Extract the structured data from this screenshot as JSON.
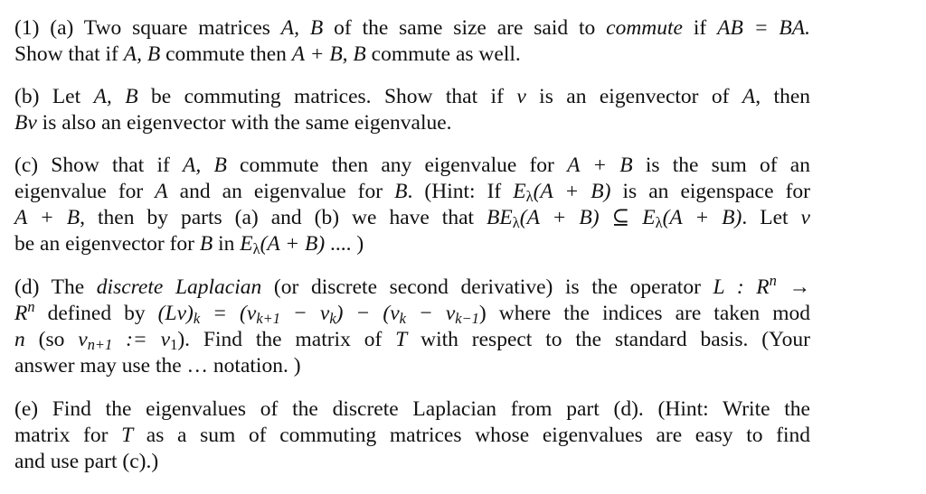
{
  "problem_number": "(1)",
  "parts": [
    {
      "label": "(a)",
      "lines": [
        "(1) (a) Two square matrices A, B of the same size are said to commute if AB = BA.",
        "Show that if A, B commute then A + B, B commute as well."
      ]
    },
    {
      "label": "(b)",
      "lines": [
        "(b) Let A, B be commuting matrices. Show that if v is an eigenvector of A, then",
        "Bv is also an eigenvector with the same eigenvalue."
      ]
    },
    {
      "label": "(c)",
      "lines": [
        "(c) Show that if A, B commute then any eigenvalue for A + B is the sum of an",
        "eigenvalue for A and an eigenvalue for B. (Hint: If Eλ(A + B) is an eigenspace for",
        "A + B, then by parts (a) and (b) we have that BEλ(A + B) ⊆ Eλ(A + B). Let v",
        "be an eigenvector for B in Eλ(A + B) .... )"
      ]
    },
    {
      "label": "(d)",
      "lines": [
        "(d) The discrete Laplacian (or discrete second derivative) is the operator L : R^n →",
        "R^n defined by (Lv)_k = (v_{k+1} − v_k) − (v_k − v_{k−1}) where the indices are taken mod",
        "n (so v_{n+1} := v_1). Find the matrix of T with respect to the standard basis. (Your",
        "answer may use the ... notation. )"
      ]
    },
    {
      "label": "(e)",
      "lines": [
        "(e) Find the eigenvalues of the discrete Laplacian from part (d). (Hint: Write the",
        "matrix for T as a sum of commuting matrices whose eigenvalues are easy to find",
        "and use part (c).)"
      ]
    }
  ],
  "text": {
    "a1_pre": "(1) (a) Two square matrices ",
    "a1_AB": "A, B",
    "a1_mid": " of the same size are said to ",
    "a1_commute": "commute",
    "a1_if": " if ",
    "a1_eq": "AB = BA.",
    "a2_pre": "Show that if ",
    "a2_AB": "A, B",
    "a2_mid": " commute then ",
    "a2_sum": "A + B, B",
    "a2_end": " commute as well.",
    "b1_pre": "(b) Let ",
    "b1_AB": "A, B",
    "b1_mid": " be commuting matrices. Show that if ",
    "b1_v": "v",
    "b1_mid2": " is an eigenvector of ",
    "b1_A": "A",
    "b1_end": ", then",
    "b2_Bv": "Bv",
    "b2_end": " is also an eigenvector with the same eigenvalue.",
    "c1_pre": "(c) Show that if ",
    "c1_AB": "A, B",
    "c1_mid": " commute then any eigenvalue for ",
    "c1_sum": "A + B",
    "c1_end": " is the sum of an",
    "c2_pre": "eigenvalue for ",
    "c2_A": "A",
    "c2_mid": " and an eigenvalue for ",
    "c2_B": "B",
    "c2_mid2": ". (Hint: If ",
    "c2_E": "E",
    "c2_lambda": "λ",
    "c2_arg": "(A + B)",
    "c2_end": " is an eigenspace for",
    "c3_sum": "A + B",
    "c3_mid": ", then by parts (a) and (b) we have that ",
    "c3_BE": "BE",
    "c3_lambda1": "λ",
    "c3_arg1": "(A + B) ⊆ E",
    "c3_lambda2": "λ",
    "c3_arg2": "(A + B)",
    "c3_mid2": ". Let ",
    "c3_v": "v",
    "c4_pre": "be an eigenvector for ",
    "c4_B": "B",
    "c4_in": " in ",
    "c4_E": "E",
    "c4_lambda": "λ",
    "c4_arg": "(A + B)",
    "c4_end": " .... )",
    "d1_pre": "(d) The ",
    "d1_term": "discrete Laplacian",
    "d1_mid": " (or discrete second derivative) is the operator ",
    "d1_L": "L : R",
    "d1_n": "n",
    "d1_arrow": " →",
    "d2_R": "R",
    "d2_n": "n",
    "d2_def": " defined by ",
    "d2_Lv": "(Lv)",
    "d2_k": "k",
    "d2_eq": " = (v",
    "d2_k1": "k+1",
    "d2_minus": " − v",
    "d2_k2": "k",
    "d2_mid": ") − (v",
    "d2_k3": "k",
    "d2_minus2": " − v",
    "d2_km1": "k−1",
    "d2_close": ")",
    "d2_end": " where the indices are taken mod",
    "d3_n": "n",
    "d3_so": " (so ",
    "d3_v": "v",
    "d3_n1": "n+1",
    "d3_assign": " := v",
    "d3_1": "1",
    "d3_mid": "). Find the matrix of ",
    "d3_T": "T",
    "d3_end": " with respect to the standard basis. (Your",
    "d4_text": "answer may use the … notation. )",
    "e1_text": "(e) Find the eigenvalues of the discrete Laplacian from part (d). (Hint: Write the",
    "e2_pre": "matrix for ",
    "e2_T": "T",
    "e2_end": " as a sum of commuting matrices whose eigenvalues are easy to find",
    "e3_text": "and use part (c).)"
  }
}
